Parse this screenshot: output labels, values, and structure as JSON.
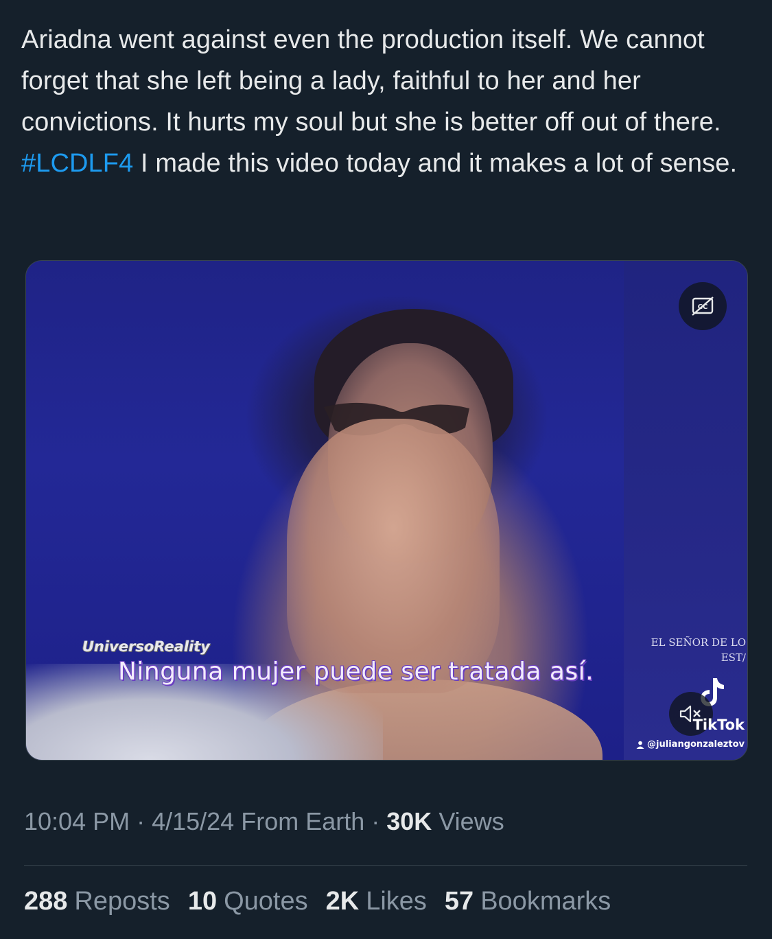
{
  "tweet": {
    "text_before": "Ariadna went against even the production itself. We cannot forget that she left being a lady, faithful to her and her convictions. It hurts my soul but she is better off out of there. ",
    "hashtag": "#LCDLF4",
    "text_after": " I made this video today and it makes a lot of sense."
  },
  "video": {
    "cc_icon": "closed-captions-off-icon",
    "mute_icon": "speaker-muted-icon",
    "watermark": "UniversoReality",
    "subtitle": "Ninguna mujer puede ser tratada así.",
    "channel_line1": "EL SEÑOR DE LO",
    "channel_line2": "EST/",
    "tiktok_word": "TikTok",
    "tiktok_handle": "@juliangonzaleztov"
  },
  "meta": {
    "time": "10:04 PM",
    "sep1": " · ",
    "date": "4/15/24",
    "source": " From Earth",
    "sep2": " · ",
    "views_count": "30K",
    "views_label": " Views"
  },
  "stats": [
    {
      "count": "288",
      "label": "Reposts"
    },
    {
      "count": "10",
      "label": "Quotes"
    },
    {
      "count": "2K",
      "label": "Likes"
    },
    {
      "count": "57",
      "label": "Bookmarks"
    }
  ],
  "colors": {
    "background": "#15202b",
    "text": "#e7e9ea",
    "secondary": "#8b98a5",
    "link": "#1d9bf0"
  }
}
